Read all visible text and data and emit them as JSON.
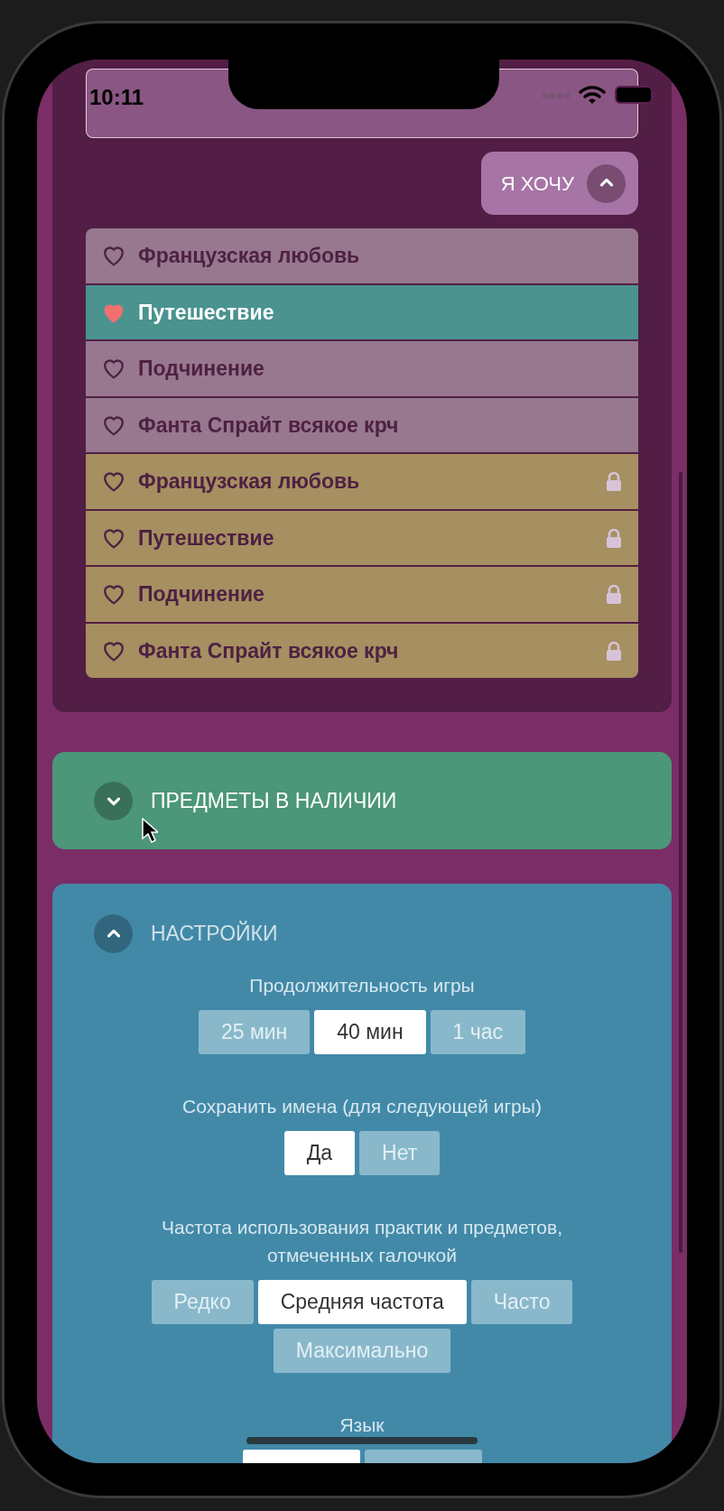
{
  "status_bar": {
    "time": "10:11"
  },
  "wish_panel": {
    "toggle": {
      "label": "Я ХОЧУ",
      "expanded": true
    },
    "items": [
      {
        "label": "Французская любовь",
        "selected": false,
        "locked": false
      },
      {
        "label": "Путешествие",
        "selected": true,
        "locked": false
      },
      {
        "label": "Подчинение",
        "selected": false,
        "locked": false
      },
      {
        "label": "Фанта Спрайт всякое крч",
        "selected": false,
        "locked": false
      },
      {
        "label": "Французская любовь",
        "selected": false,
        "locked": true
      },
      {
        "label": "Путешествие",
        "selected": false,
        "locked": true
      },
      {
        "label": "Подчинение",
        "selected": false,
        "locked": true
      },
      {
        "label": "Фанта Спрайт всякое крч",
        "selected": false,
        "locked": true
      }
    ]
  },
  "sections": [
    {
      "title": "ПРЕДМЕТЫ В НАЛИЧИИ",
      "expanded": false,
      "color": "#4c9679"
    },
    {
      "title": "НАСТРОЙКИ",
      "expanded": true,
      "color": "#4289a8",
      "settings": [
        {
          "label": "Продолжительность игры",
          "options": [
            {
              "label": "25 мин",
              "selected": false
            },
            {
              "label": "40 мин",
              "selected": true
            },
            {
              "label": "1 час",
              "selected": false
            }
          ]
        },
        {
          "label": "Сохранить имена (для следующей игры)",
          "options": [
            {
              "label": "Да",
              "selected": true
            },
            {
              "label": "Нет",
              "selected": false
            }
          ]
        },
        {
          "label": "Частота использования практик и предметов, отмеченных галочкой",
          "options": [
            {
              "label": "Редко",
              "selected": false
            },
            {
              "label": "Средняя частота",
              "selected": true
            },
            {
              "label": "Часто",
              "selected": false
            },
            {
              "label": "Максимально",
              "selected": false
            }
          ]
        },
        {
          "label": "Язык",
          "options": [
            {
              "selected": true
            },
            {
              "selected": false
            }
          ]
        }
      ]
    }
  ]
}
